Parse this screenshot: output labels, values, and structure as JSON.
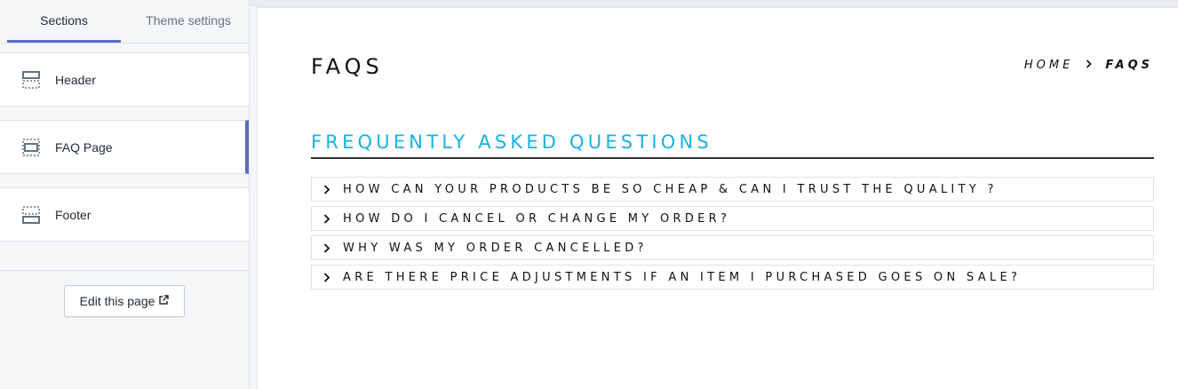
{
  "sidebar": {
    "tabs": [
      {
        "label": "Sections"
      },
      {
        "label": "Theme settings"
      }
    ],
    "sections": [
      {
        "label": "Header",
        "icon": "header-layout-icon"
      },
      {
        "label": "FAQ Page",
        "icon": "section-layout-icon"
      },
      {
        "label": "Footer",
        "icon": "footer-layout-icon"
      }
    ],
    "edit_button": "Edit this page"
  },
  "preview": {
    "page_title": "FAQS",
    "breadcrumb": {
      "home": "HOME",
      "separator": "›",
      "current": "FAQS"
    },
    "faq_heading": "FREQUENTLY ASKED QUESTIONS",
    "questions": [
      "HOW CAN YOUR PRODUCTS BE SO CHEAP & CAN I TRUST THE QUALITY ?",
      "HOW DO I CANCEL OR CHANGE MY ORDER?",
      "WHY WAS MY ORDER CANCELLED?",
      "ARE THERE PRICE ADJUSTMENTS IF AN ITEM I PURCHASED GOES ON SALE?"
    ]
  },
  "colors": {
    "accent": "#5c6ac4",
    "heading": "#19b1e2"
  }
}
